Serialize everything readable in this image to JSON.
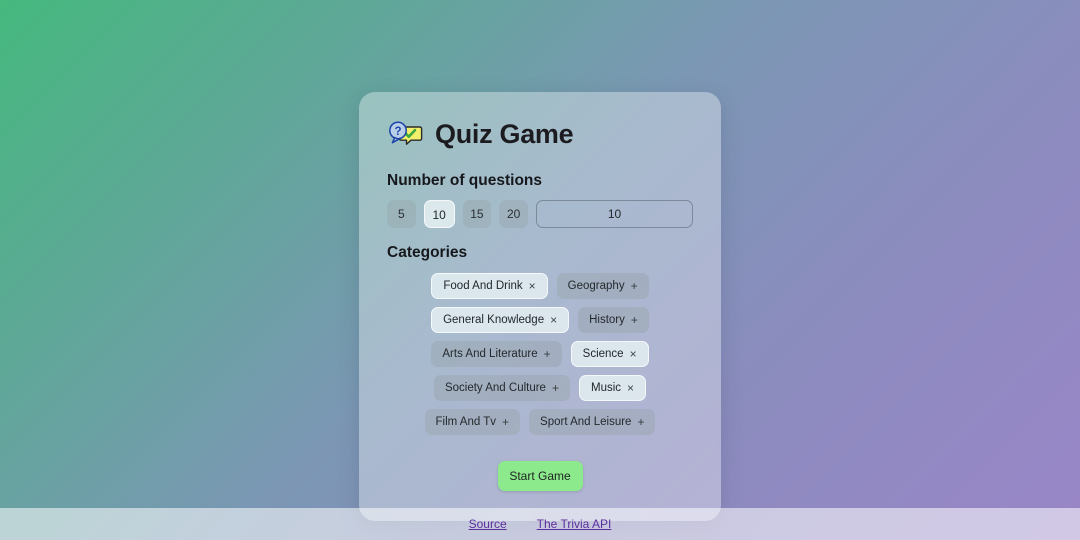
{
  "app": {
    "title": "Quiz Game",
    "logo_icon": "quiz-speech-bubble-icon"
  },
  "question_count": {
    "label": "Number of questions",
    "options": [
      {
        "label": "5",
        "value": 5,
        "selected": false
      },
      {
        "label": "10",
        "value": 10,
        "selected": true
      },
      {
        "label": "15",
        "value": 15,
        "selected": false
      },
      {
        "label": "20",
        "value": 20,
        "selected": false
      }
    ],
    "custom_input_value": "10"
  },
  "categories": {
    "label": "Categories",
    "add_mark": "+",
    "remove_mark": "×",
    "items": [
      {
        "label": "Food And Drink",
        "selected": true,
        "mark": "×"
      },
      {
        "label": "Geography",
        "selected": false,
        "mark": "+"
      },
      {
        "label": "General Knowledge",
        "selected": true,
        "mark": "×"
      },
      {
        "label": "History",
        "selected": false,
        "mark": "+"
      },
      {
        "label": "Arts And Literature",
        "selected": false,
        "mark": "+"
      },
      {
        "label": "Science",
        "selected": true,
        "mark": "×"
      },
      {
        "label": "Society And Culture",
        "selected": false,
        "mark": "+"
      },
      {
        "label": "Music",
        "selected": true,
        "mark": "×"
      },
      {
        "label": "Film And Tv",
        "selected": false,
        "mark": "+"
      },
      {
        "label": "Sport And Leisure",
        "selected": false,
        "mark": "+"
      }
    ]
  },
  "actions": {
    "start_label": "Start Game"
  },
  "footer": {
    "links": [
      {
        "label": "Source"
      },
      {
        "label": "The Trivia API"
      }
    ]
  },
  "colors": {
    "gradient_start": "#45b97e",
    "gradient_end": "#9a86c8",
    "start_button": "#8ce98c",
    "link": "#5b2f9e"
  }
}
